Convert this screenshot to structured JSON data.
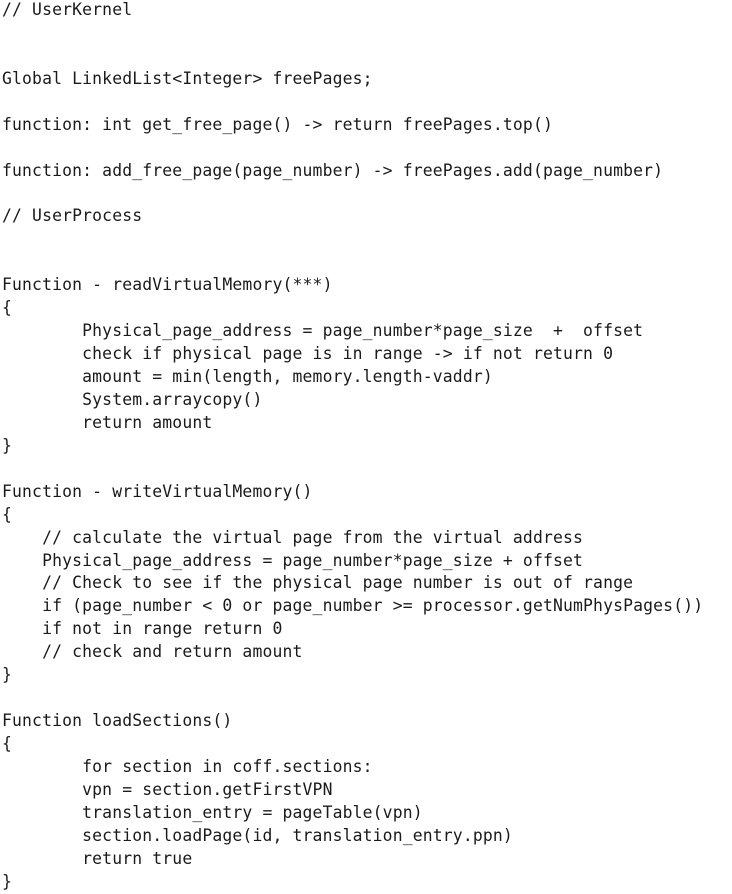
{
  "document": {
    "lines": [
      "// UserKernel",
      "",
      "",
      "Global LinkedList<Integer> freePages;",
      "",
      "function: int get_free_page() -> return freePages.top()",
      "",
      "function: add_free_page(page_number) -> freePages.add(page_number)",
      "",
      "// UserProcess",
      "",
      "",
      "Function - readVirtualMemory(***)",
      "{",
      "        Physical_page_address = page_number*page_size  +  offset",
      "        check if physical page is in range -> if not return 0",
      "        amount = min(length, memory.length-vaddr)",
      "        System.arraycopy()",
      "        return amount",
      "}",
      "",
      "Function - writeVirtualMemory()",
      "{",
      "    // calculate the virtual page from the virtual address",
      "    Physical_page_address = page_number*page_size + offset",
      "    // Check to see if the physical page number is out of range",
      "    if (page_number < 0 or page_number >= processor.getNumPhysPages())",
      "    if not in range return 0",
      "    // check and return amount",
      "}",
      "",
      "Function loadSections()",
      "{",
      "        for section in coff.sections:",
      "        vpn = section.getFirstVPN",
      "        translation_entry = pageTable(vpn)",
      "        section.loadPage(id, translation_entry.ppn)",
      "        return true",
      "}"
    ]
  }
}
